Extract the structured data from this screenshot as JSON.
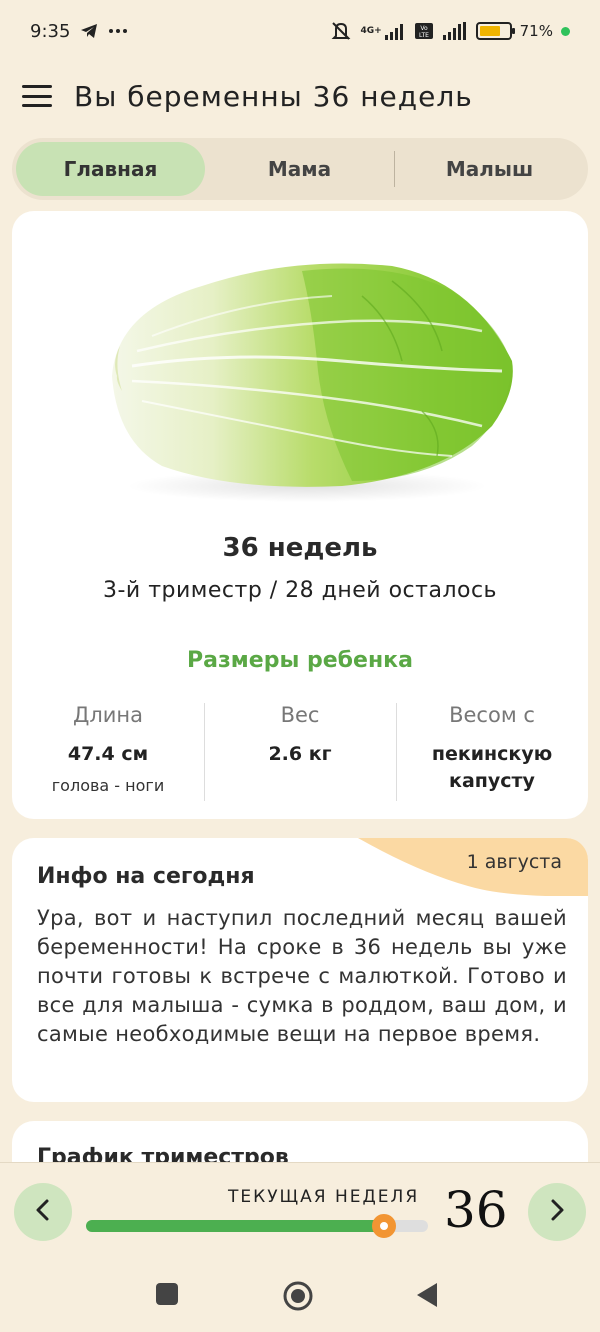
{
  "status_bar": {
    "time": "9:35",
    "network": "4G+",
    "battery_percent": "71",
    "battery_level": 0.71,
    "icons": [
      "telegram-icon",
      "more-icon",
      "mute-icon",
      "signal-icon",
      "volte-icon",
      "signal-icon",
      "battery-icon"
    ]
  },
  "header": {
    "title": "Вы беременны 36 недель",
    "menu_icon": "hamburger-icon"
  },
  "tabs": [
    {
      "label": "Главная",
      "active": true
    },
    {
      "label": "Мама",
      "active": false
    },
    {
      "label": "Малыш",
      "active": false
    }
  ],
  "week_card": {
    "image": "napa-cabbage",
    "title": "36 недель",
    "subtitle": "3-й триместр / 28 дней осталось",
    "sizes_heading": "Размеры ребенка",
    "stats": [
      {
        "label": "Длина",
        "value": "47.4 см",
        "sub": "голова - ноги"
      },
      {
        "label": "Вес",
        "value": "2.6 кг",
        "sub": ""
      },
      {
        "label": "Весом с",
        "value": "пекинскую капусту",
        "sub": ""
      }
    ]
  },
  "info_card": {
    "title": "Инфо на сегодня",
    "date": "1 августа",
    "text": "Ура, вот и наступил последний месяц вашей беременности! На сроке в 36 недель вы уже почти готовы к встрече с малюткой. Готово и все для малыша - сумка в роддом, ваш дом, и самые необходимые вещи на первое время."
  },
  "next_card": {
    "title": "График триместров"
  },
  "bottom_bar": {
    "label": "ТЕКУЩАЯ НЕДЕЛЯ",
    "week": "36",
    "progress": 0.87,
    "prev_icon": "chevron-left-icon",
    "next_icon": "chevron-right-icon"
  },
  "colors": {
    "background": "#f7eedd",
    "accent_green": "#4caf50",
    "tab_active": "#c8e2b4",
    "knob_orange": "#f29533",
    "date_badge": "#fbd9a3"
  }
}
